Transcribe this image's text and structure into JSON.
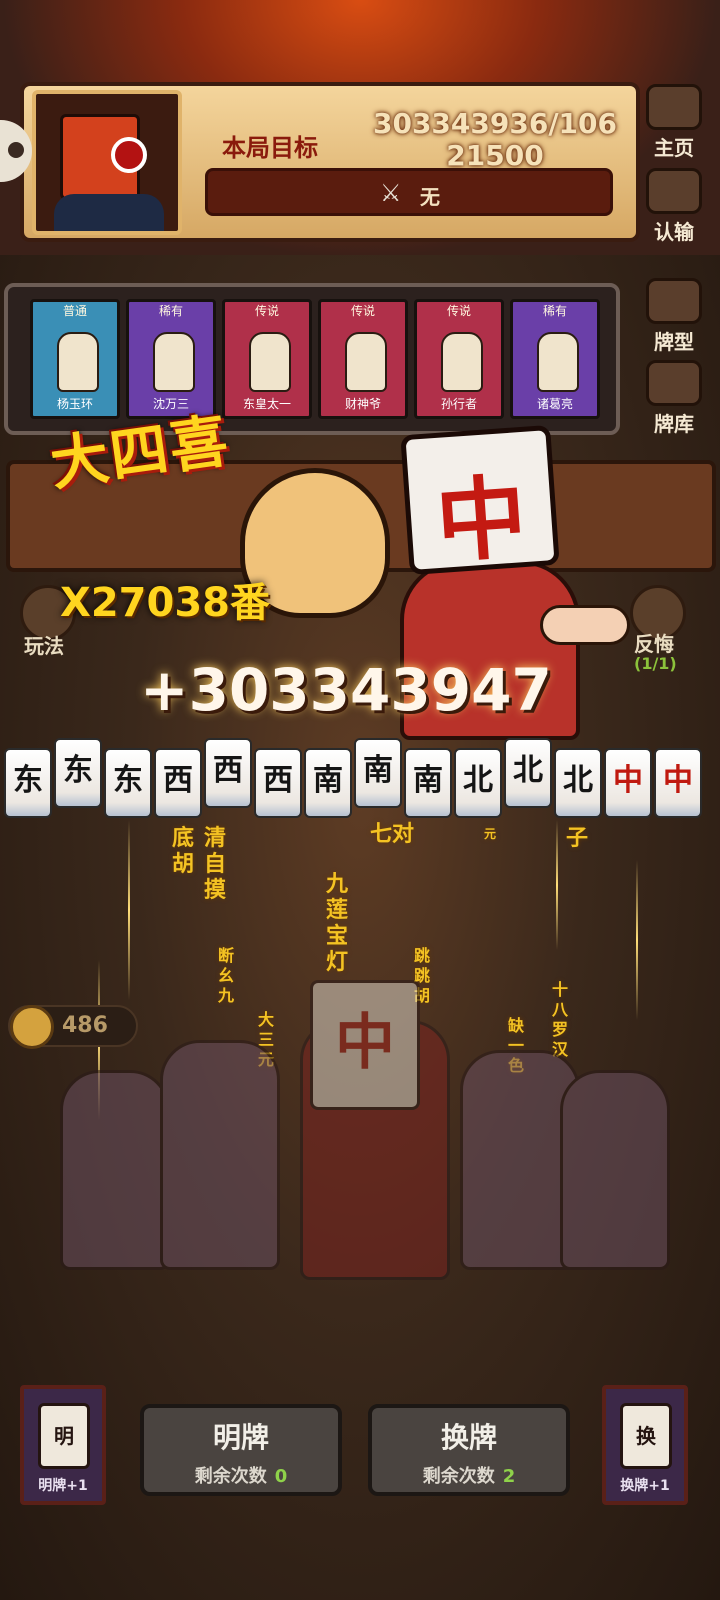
{
  "header": {
    "goal_label": "本局目标",
    "goal_value": "303343936/106 21500",
    "goal_condition": "无",
    "goal_condition_icon": "crossed-swords-icon"
  },
  "right_menu": [
    {
      "label": "主页",
      "icon": "home-icon"
    },
    {
      "label": "认输",
      "icon": "white-flag-icon"
    },
    {
      "label": "牌型",
      "icon": "tile-book-icon"
    },
    {
      "label": "牌库",
      "icon": "tile-deck-icon"
    }
  ],
  "cards": [
    {
      "rarity": "普通",
      "name": "杨玉环",
      "color": "#3a8fb6"
    },
    {
      "rarity": "稀有",
      "name": "沈万三",
      "color": "#6a3fa8"
    },
    {
      "rarity": "传说",
      "name": "东皇太一",
      "color": "#b0304a"
    },
    {
      "rarity": "传说",
      "name": "财神爷",
      "color": "#b0304a"
    },
    {
      "rarity": "传说",
      "name": "孙行者",
      "color": "#b0304a"
    },
    {
      "rarity": "稀有",
      "name": "诸葛亮",
      "color": "#6a3fa8"
    }
  ],
  "left_side": {
    "label": "玩法"
  },
  "right_side": {
    "label": "反悔",
    "count": "(1/1)"
  },
  "combo": {
    "name": "大四喜",
    "multiplier": "X27038番",
    "score_gain": "+303343947"
  },
  "tiles": [
    {
      "char": "东",
      "red": false,
      "raised": false
    },
    {
      "char": "东",
      "red": false,
      "raised": true
    },
    {
      "char": "东",
      "red": false,
      "raised": false
    },
    {
      "char": "西",
      "red": false,
      "raised": false
    },
    {
      "char": "西",
      "red": false,
      "raised": true
    },
    {
      "char": "西",
      "red": false,
      "raised": false
    },
    {
      "char": "南",
      "red": false,
      "raised": false
    },
    {
      "char": "南",
      "red": false,
      "raised": true
    },
    {
      "char": "南",
      "red": false,
      "raised": false
    },
    {
      "char": "北",
      "red": false,
      "raised": false
    },
    {
      "char": "北",
      "red": false,
      "raised": true
    },
    {
      "char": "北",
      "red": false,
      "raised": false
    },
    {
      "char": "中",
      "red": true,
      "raised": false
    },
    {
      "char": "中",
      "red": true,
      "raised": false
    }
  ],
  "floating_hands": [
    "底胡",
    "清自摸",
    "七对",
    "子",
    "九莲宝灯",
    "断幺九",
    "跳跳胡",
    "十八罗汉",
    "大三元",
    "缺一色",
    "元"
  ],
  "coins": {
    "value": "486"
  },
  "bottom": {
    "left_card_label": "明牌+1",
    "left_card_glyph": "明",
    "right_card_label": "换牌+1",
    "right_card_glyph": "换",
    "reveal_button": {
      "title": "明牌",
      "sub": "剩余次数",
      "count": "0"
    },
    "swap_button": {
      "title": "换牌",
      "sub": "剩余次数",
      "count": "2"
    }
  }
}
